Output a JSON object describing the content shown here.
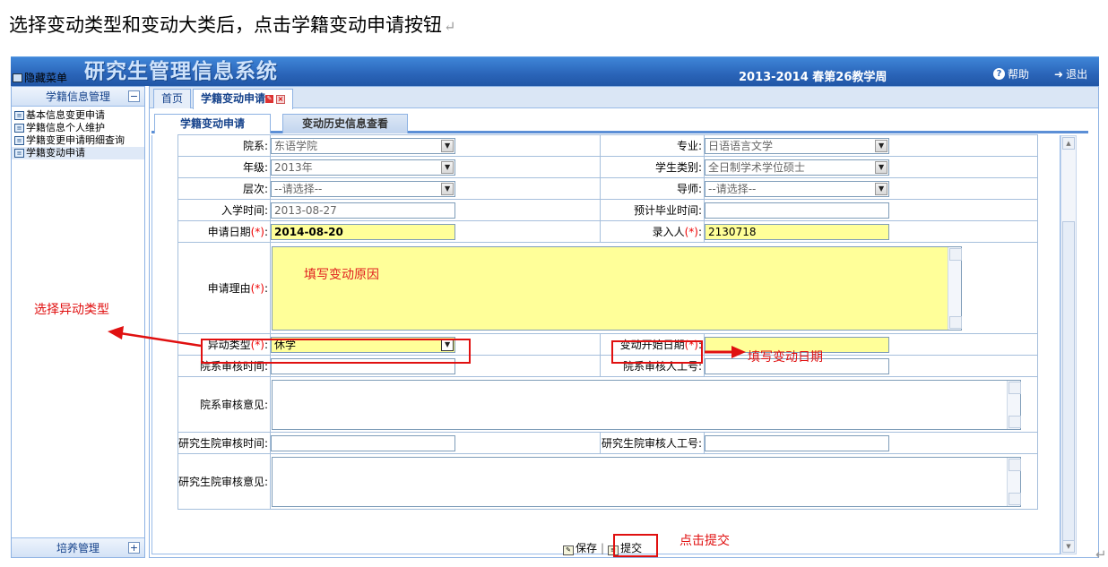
{
  "doc_heading": "选择变动类型和变动大类后，点击学籍变动申请按钮",
  "return_mark": "↵",
  "banner": {
    "hide_menu": "隐藏菜单",
    "system_title": "研究生管理信息系统",
    "week": "2013-2014 春第26教学周",
    "help": "帮助",
    "logout": "退出"
  },
  "sidebar": {
    "section": "学籍信息管理",
    "collapse_symbol": "−",
    "items": [
      {
        "label": "基本信息变更申请"
      },
      {
        "label": "学籍信息个人维护"
      },
      {
        "label": "学籍变更申请明细查询"
      },
      {
        "label": "学籍变动申请"
      }
    ],
    "footer": "培养管理",
    "expand_symbol": "+"
  },
  "tabs": {
    "home": "首页",
    "active": "学籍变动申请"
  },
  "subtabs": {
    "apply": "学籍变动申请",
    "history": "变动历史信息查看"
  },
  "form": {
    "department": {
      "label": "院系:",
      "value": "东语学院"
    },
    "major": {
      "label": "专业:",
      "value": "日语语言文学"
    },
    "grade": {
      "label": "年级:",
      "value": "2013年"
    },
    "student_type": {
      "label": "学生类别:",
      "value": "全日制学术学位硕士"
    },
    "level": {
      "label": "层次:",
      "value": "--请选择--"
    },
    "advisor": {
      "label": "导师:",
      "value": "--请选择--"
    },
    "enroll_time": {
      "label": "入学时间:",
      "value": "2013-08-27"
    },
    "grad_time": {
      "label": "预计毕业时间:",
      "value": ""
    },
    "apply_date": {
      "label": "申请日期",
      "value": "2014-08-20"
    },
    "recorder": {
      "label": "录入人",
      "value": "2130718"
    },
    "reason": {
      "label": "申请理由",
      "hint": "填写变动原因"
    },
    "change_type": {
      "label": "异动类型",
      "value": "休学"
    },
    "change_start": {
      "label": "变动开始日期",
      "value": ""
    },
    "dept_review_time": {
      "label": "院系审核时间:",
      "value": ""
    },
    "dept_reviewer_id": {
      "label": "院系审核人工号:",
      "value": ""
    },
    "dept_opinion": {
      "label": "院系审核意见:"
    },
    "grad_review_time": {
      "label": "研究生院审核时间:",
      "value": ""
    },
    "grad_reviewer_id": {
      "label": "研究生院审核人工号:",
      "value": ""
    },
    "grad_opinion": {
      "label": "研究生院审核意见:"
    },
    "req_mark": "(*)",
    "colon": ":"
  },
  "buttons": {
    "save": "保存",
    "separator": "|",
    "submit": "提交"
  },
  "annotations": {
    "select_type": "选择异动类型",
    "fill_date": "填写变动日期",
    "click_submit": "点击提交",
    "color": "#e01010"
  }
}
